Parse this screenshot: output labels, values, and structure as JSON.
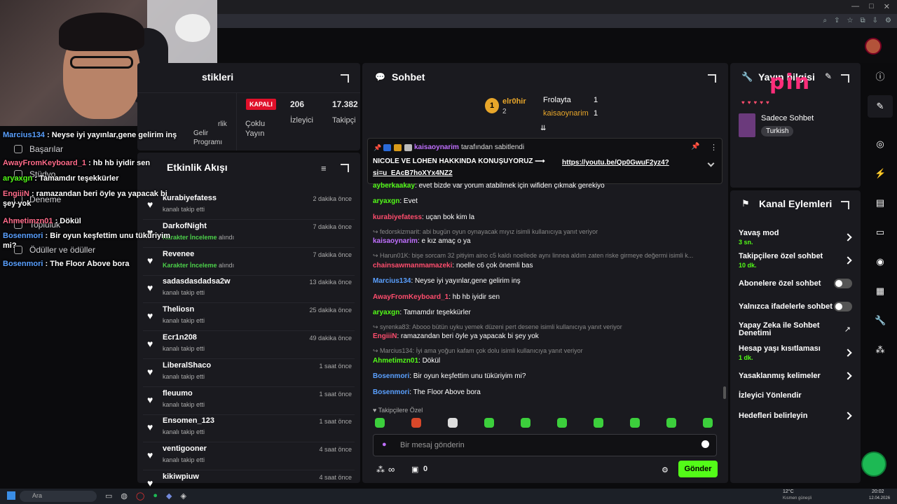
{
  "browser": {
    "min": "—",
    "max": "□",
    "close": "✕"
  },
  "stats": {
    "title": "stikleri",
    "kapali": "KAPALI",
    "coklu": "Çoklu Yayın",
    "viewers_value": "206",
    "viewers_label": "İzleyici",
    "followers_value": "17.382",
    "followers_label": "Takipçi",
    "gelir": "Gelir Programı",
    "rlik": "rlik"
  },
  "left_nav": {
    "basarilar": "Başarılar",
    "studyo": "Stüdyo",
    "deneme": "Deneme",
    "topluluk": "Topluluk",
    "odul": "Ödüller ve ödüller"
  },
  "activity": {
    "title": "Etkinlik Akışı",
    "rows": [
      {
        "name": "kurabiyefatess",
        "sub": "kanalı takip etti",
        "time": "2 dakika önce"
      },
      {
        "name": "DarkofNight",
        "sub_green": "Karakter İnceleme",
        "sub": " alındı",
        "time": "7 dakika önce"
      },
      {
        "name": "Revenee",
        "sub_green": "Karakter İnceleme",
        "sub": " alındı",
        "time": "7 dakika önce"
      },
      {
        "name": "sadasdasdadsa2w",
        "sub": "kanalı takip etti",
        "time": "13 dakika önce"
      },
      {
        "name": "Theliosn",
        "sub": "kanalı takip etti",
        "time": "25 dakika önce"
      },
      {
        "name": "Ecr1n208",
        "sub": "kanalı takip etti",
        "time": "49 dakika önce"
      },
      {
        "name": "LiberalShaco",
        "sub": "kanalı takip etti",
        "time": "1 saat önce"
      },
      {
        "name": "fleuumo",
        "sub": "kanalı takip etti",
        "time": "1 saat önce"
      },
      {
        "name": "Ensomen_123",
        "sub": "kanalı takip etti",
        "time": "1 saat önce"
      },
      {
        "name": "ventigooner",
        "sub": "kanalı takip etti",
        "time": "4 saat önce"
      },
      {
        "name": "kikiwpiuw",
        "sub": "",
        "time": "4 saat önce"
      }
    ]
  },
  "chat": {
    "title": "Sohbet",
    "top": {
      "first_name": "elr0hir",
      "first_count": "2",
      "second_name": "Frolayta",
      "second_count": "1",
      "third_name": "kaisaoynarim",
      "third_count": "1",
      "rank": "1"
    },
    "pinned": {
      "by_user": "kaisaoynarim",
      "by_suffix": "tarafından sabitlendi",
      "text": "NICOLE VE LOHEN HAKKINDA KONUŞUYORUZ ⟶",
      "link": "https://youtu.be/Qp0GwuF2yz4?si=u_EAcB7hoXYx4NZ2"
    },
    "messages": [
      {
        "user": "ayberkaakay",
        "color": "#53fc18",
        "text": ": evet bizde var yorum atabilmek için wifiden çıkmak gerekiyo"
      },
      {
        "user": "aryaxgn",
        "color": "#53fc18",
        "text": ": Evet"
      },
      {
        "user": "kurabiyefatess",
        "color": "#ff4d6d",
        "text": ": uçan bok kim la"
      },
      {
        "reply": "fedorskizmarit: abi bugün oyun oynayacak mıyız isimli kullanıcıya yanıt veriyor"
      },
      {
        "user": "kaisaoynarim",
        "color": "#c070ff",
        "text": ": e kız amaç o ya"
      },
      {
        "reply": "Harun01K: bişe sorcam 32 pitiyim aino c5 kaldı noellede aynı linnea aldım zaten riske girmeye değermi isimli k..."
      },
      {
        "user": "chainsawmanmamazeki",
        "color": "#ff4d6d",
        "text": ": noelle c6 çok önemli bas"
      },
      {
        "user": "Marcius134",
        "color": "#5aa0ff",
        "text": ": Neyse iyi yayınlar,gene gelirim inş"
      },
      {
        "user": "AwayFromKeyboard_1",
        "color": "#ff4d6d",
        "text": ": hb hb iyidir sen"
      },
      {
        "user": "aryaxgn",
        "color": "#53fc18",
        "text": ": Tamamdır teşekkürler"
      },
      {
        "reply": "syrenka83: Abooo bütün uyku yemek düzeni pert desene isimli kullanıcıya yanıt veriyor"
      },
      {
        "user": "EngiiiN",
        "color": "#ff4d6d",
        "text": ": ramazandan beri öyle ya yapacak bi şey yok"
      },
      {
        "reply": "Marcius134: İyi ama yoğun  kafam çok dolu isimli kullanıcıya yanıt veriyor"
      },
      {
        "user": "Ahmetimzn01",
        "color": "#53fc18",
        "text": ": Dökül"
      },
      {
        "user": "Bosenmori",
        "color": "#5aa0ff",
        "text": ": Bir oyun keşfettim unu tüküriyim mi?"
      },
      {
        "user": "Bosenmori",
        "color": "#5aa0ff",
        "text": ": The Floor Above bora"
      }
    ],
    "followers_only": "Takipçilere Özel",
    "input_placeholder": "Bir mesaj gönderin",
    "send": "Gönder",
    "infinity": "∞",
    "zero": "0"
  },
  "info": {
    "title": "Yayın bilgisi",
    "subtitle": "Sadece Sohbet",
    "tag": "Turkish"
  },
  "actions": {
    "title": "Kanal Eylemleri",
    "slow": "Yavaş mod",
    "slow_v": "3 sn.",
    "follow_only": "Takipçilere özel sohbet",
    "follow_only_v": "10 dk.",
    "sub_only": "Abonelere özel sohbet",
    "emote_only": "Yalnızca ifadelerle sohbet",
    "ai": "Yapay Zeka ile Sohbet Denetimi",
    "age": "Hesap yaşı kısıtlaması",
    "age_v": "1 dk.",
    "banned": "Yasaklanmış kelimeler",
    "redirect": "İzleyici Yönlendir",
    "goals": "Hedefleri belirleyin"
  },
  "overlay": [
    {
      "user": "Marcius134",
      "color": "#5aa0ff",
      "text": " : Neyse iyi yayınlar,gene gelirim inş"
    },
    {
      "user": "AwayFromKeyboard_1",
      "color": "#ff6b8a",
      "text": " : hb hb iyidir sen"
    },
    {
      "user": "aryaxgn",
      "color": "#53fc18",
      "text": " : Tamamdır teşekkürler"
    },
    {
      "user": "EngiiiN",
      "color": "#ff6b8a",
      "text": " : ramazandan beri öyle ya yapacak bi şey yok"
    },
    {
      "user": "Ahmetimzn01",
      "color": "#ff6b8a",
      "text": " : Dökül"
    },
    {
      "user": "Bosenmori",
      "color": "#5aa0ff",
      "text": " : Bir oyun keşfettim unu tüküriyim mi?"
    },
    {
      "user": "Bosenmori",
      "color": "#5aa0ff",
      "text": " : The Floor Above bora"
    }
  ],
  "pin_logo": "pin",
  "taskbar": {
    "search": "Ara",
    "weather": "12°C",
    "weather_sub": "Kısmen güneşli",
    "time": "20:02",
    "date": "12.04.2026"
  }
}
